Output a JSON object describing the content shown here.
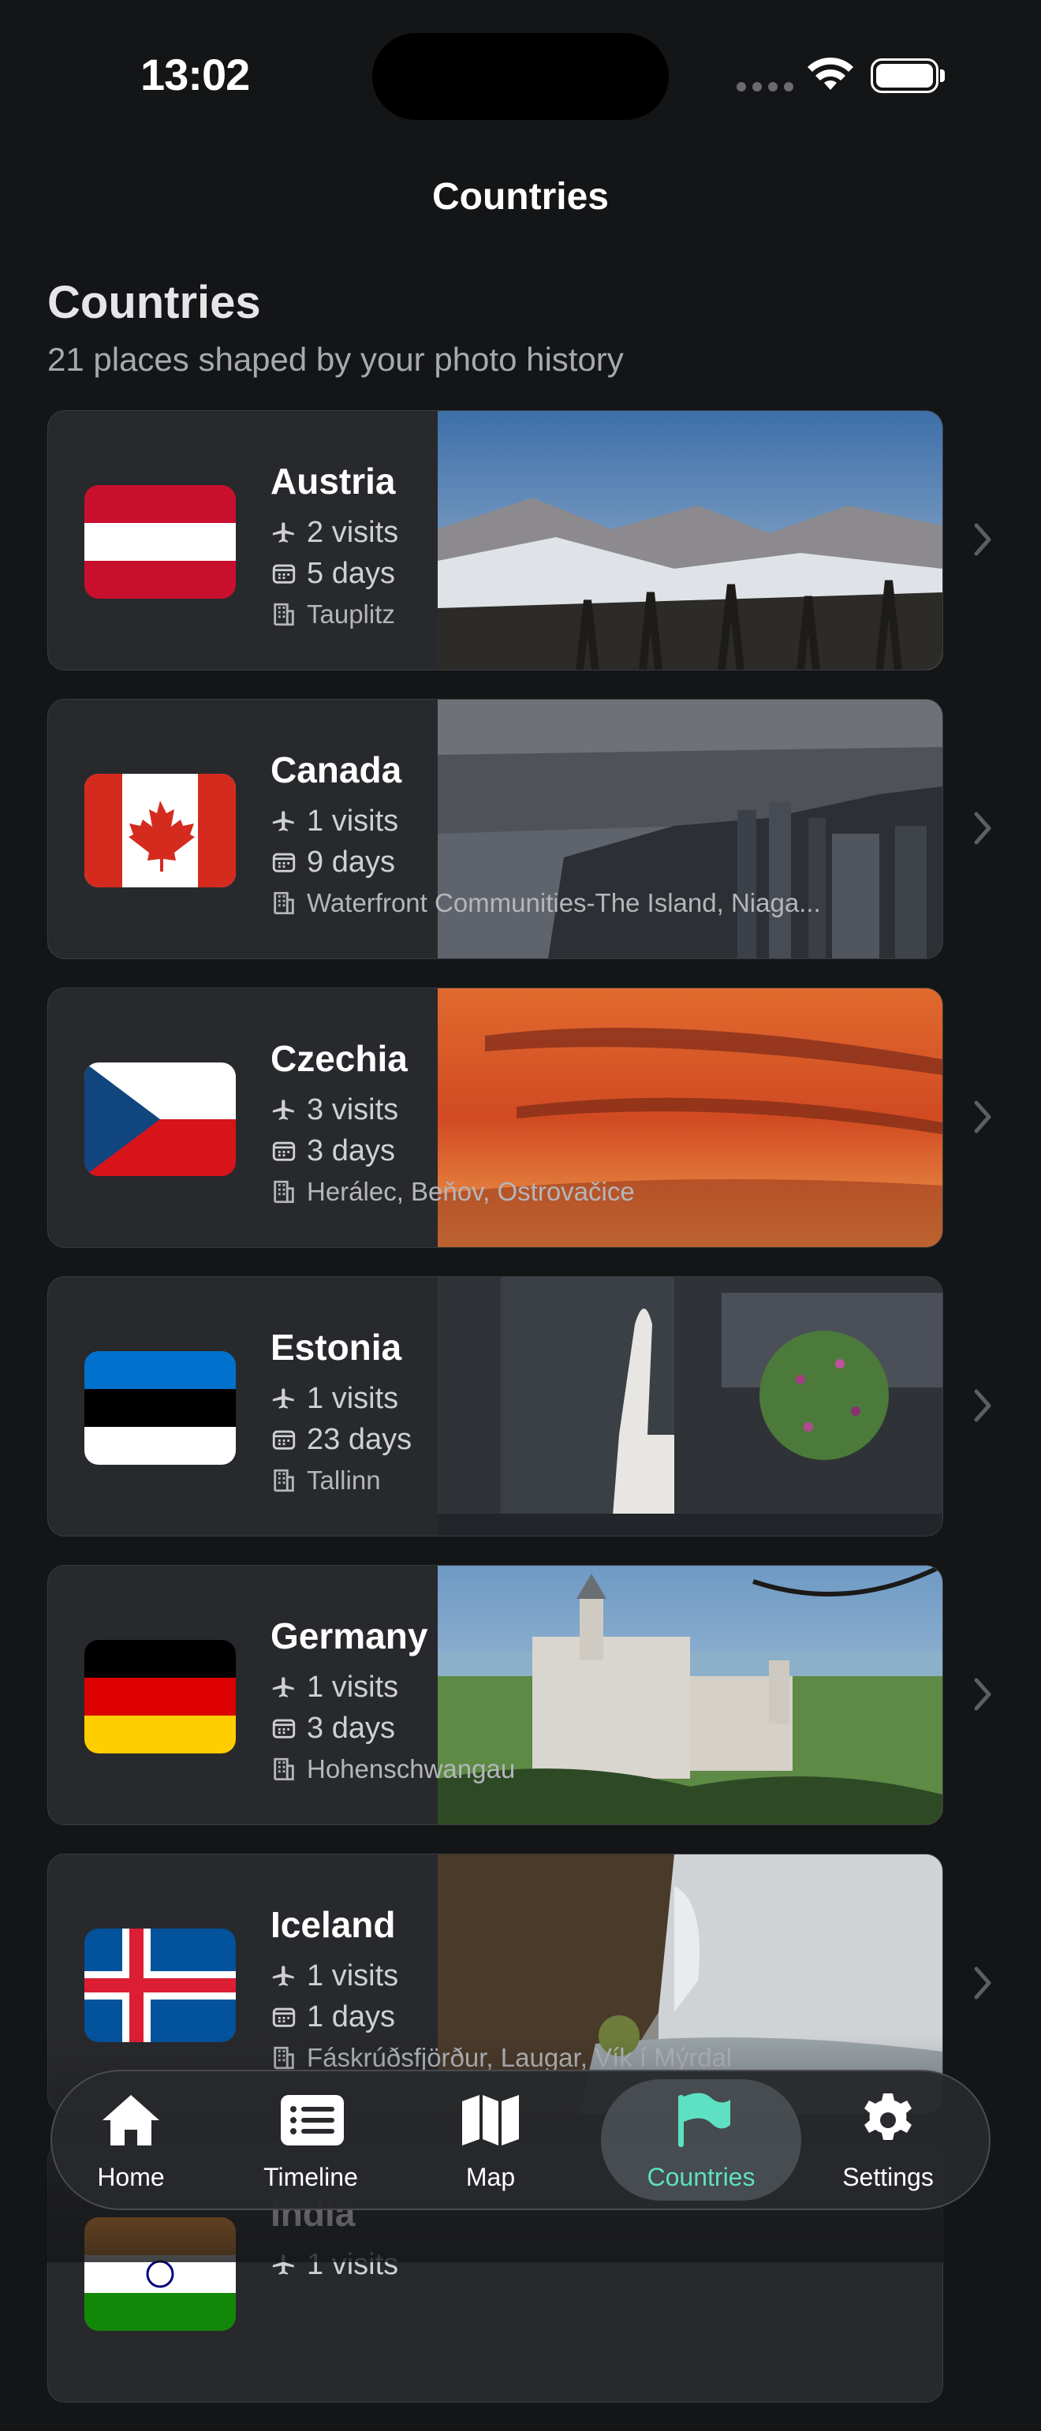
{
  "status": {
    "time": "13:02"
  },
  "nav": {
    "title": "Countries"
  },
  "header": {
    "title": "Countries",
    "subtitle": "21 places shaped by your photo history"
  },
  "countries": [
    {
      "name": "Austria",
      "visits": "2 visits",
      "days": "5 days",
      "cities": "Tauplitz"
    },
    {
      "name": "Canada",
      "visits": "1 visits",
      "days": "9 days",
      "cities": "Waterfront Communities-The Island, Niaga..."
    },
    {
      "name": "Czechia",
      "visits": "3 visits",
      "days": "3 days",
      "cities": "Herálec, Beňov, Ostrovačice"
    },
    {
      "name": "Estonia",
      "visits": "1 visits",
      "days": "23 days",
      "cities": "Tallinn"
    },
    {
      "name": "Germany",
      "visits": "1 visits",
      "days": "3 days",
      "cities": "Hohenschwangau"
    },
    {
      "name": "Iceland",
      "visits": "1 visits",
      "days": "1 days",
      "cities": "Fáskrúðsfjörður, Laugar, Vík í Mýrdal"
    },
    {
      "name": "India",
      "visits": "1 visits",
      "days": "",
      "cities": ""
    }
  ],
  "tabs": [
    {
      "label": "Home",
      "icon": "house-icon"
    },
    {
      "label": "Timeline",
      "icon": "list-icon"
    },
    {
      "label": "Map",
      "icon": "map-icon"
    },
    {
      "label": "Countries",
      "icon": "flag-icon",
      "active": true
    },
    {
      "label": "Settings",
      "icon": "gear-icon"
    }
  ],
  "colors": {
    "background": "#141517",
    "card": "#28292c",
    "accent": "#5ee0c3"
  }
}
